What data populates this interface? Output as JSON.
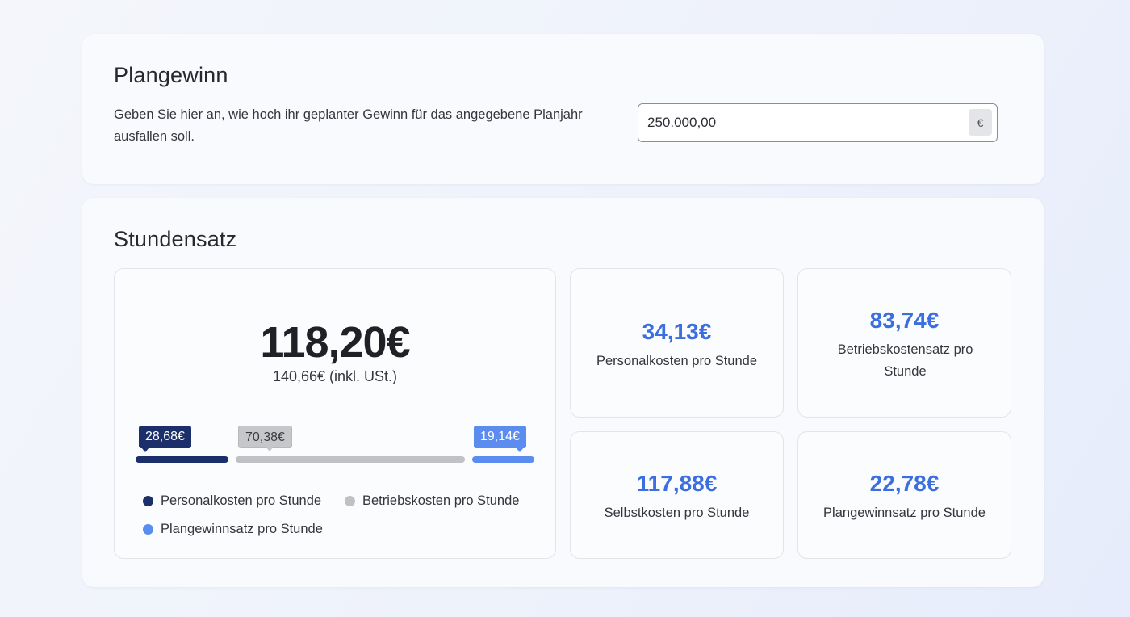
{
  "plangewinn": {
    "title": "Plangewinn",
    "description": "Geben Sie hier an, wie hoch ihr geplanter Gewinn für das angegebene Planjahr ausfallen soll.",
    "value": "250.000,00",
    "currency": "€"
  },
  "stundensatz": {
    "title": "Stundensatz",
    "total": "118,20€",
    "total_gross": "140,66€ (inkl. USt.)",
    "breakdown": [
      {
        "value": "28,68€",
        "share": 24.26,
        "color": "#1c2f6b"
      },
      {
        "value": "70,38€",
        "share": 59.54,
        "color": "#c0c1c4"
      },
      {
        "value": "19,14€",
        "share": 16.2,
        "color": "#5b8cf0"
      }
    ],
    "legend": [
      {
        "label": "Personalkosten pro Stunde",
        "color": "#1c2f6b"
      },
      {
        "label": "Betriebskosten pro Stunde",
        "color": "#c0c1c4"
      },
      {
        "label": "Plangewinnsatz pro Stunde",
        "color": "#5b8cf0"
      }
    ],
    "stats": {
      "personal": {
        "value": "34,13€",
        "label": "Personalkosten pro Stunde"
      },
      "betrieb": {
        "value": "83,74€",
        "label": "Betriebskostensatz pro Stunde"
      },
      "selbst": {
        "value": "117,88€",
        "label": "Selbstkosten pro Stunde"
      },
      "gewinn": {
        "value": "22,78€",
        "label": "Plangewinnsatz pro Stunde"
      }
    }
  }
}
